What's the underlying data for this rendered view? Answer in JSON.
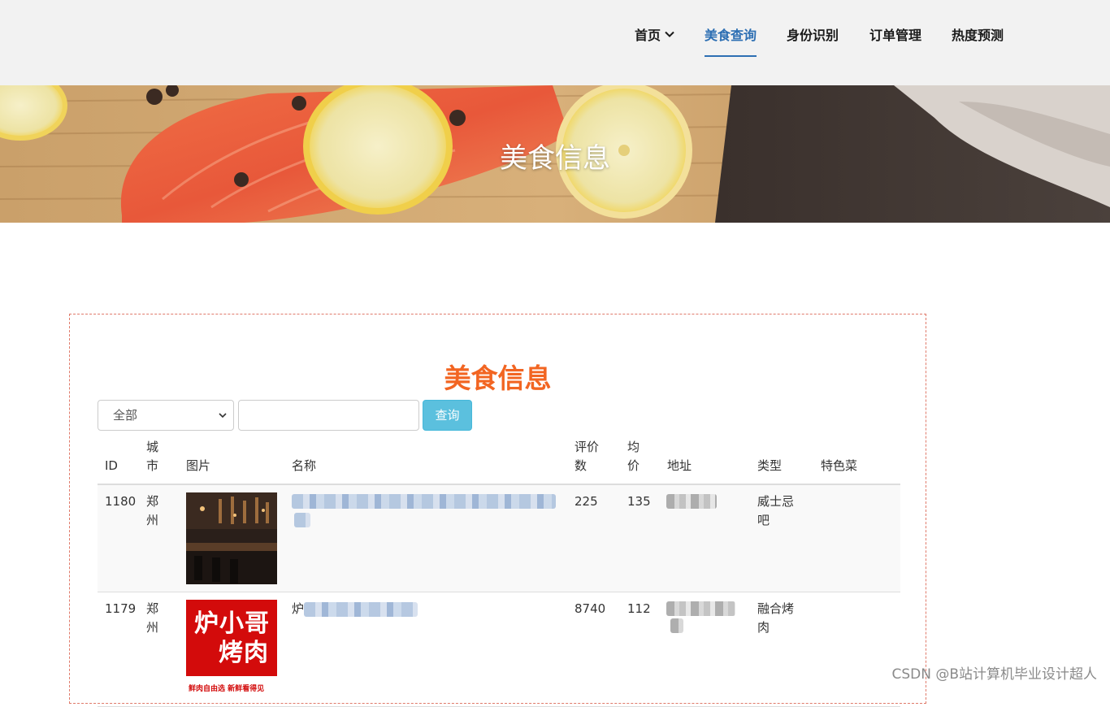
{
  "nav": {
    "items": [
      {
        "label": "首页",
        "has_dropdown": true,
        "active": false
      },
      {
        "label": "美食查询",
        "active": true
      },
      {
        "label": "身份识别",
        "active": false
      },
      {
        "label": "订单管理",
        "active": false
      },
      {
        "label": "热度预测",
        "active": false
      }
    ],
    "active_color": "#2d6fb3"
  },
  "banner": {
    "title": "美食信息"
  },
  "panel": {
    "title": "美食信息",
    "title_color": "#f26522",
    "filter": {
      "selected": "全部"
    },
    "search": {
      "value": "",
      "placeholder": ""
    },
    "search_button": "查询",
    "table": {
      "columns": [
        "ID",
        "城\n市",
        "图片",
        "名称",
        "评价\n数",
        "均\n价",
        "地址",
        "类型",
        "特色菜"
      ],
      "rows": [
        {
          "id": "1180",
          "city": "郑\n州",
          "image": "bar-interior-photo",
          "name": "",
          "reviews": "225",
          "price": "135",
          "address": "",
          "type": "威士忌\n吧",
          "dish": ""
        },
        {
          "id": "1179",
          "city": "郑\n州",
          "image": "炉小哥烤肉-logo",
          "name": "炉",
          "reviews": "8740",
          "price": "112",
          "address": "",
          "type": "融合烤\n肉",
          "dish": ""
        }
      ]
    }
  },
  "logo_text": {
    "line1": "炉小哥",
    "line2": "烤肉",
    "line3": "鲜肉自由选 新鲜看得见"
  },
  "watermark": "CSDN @B站计算机毕业设计超人"
}
